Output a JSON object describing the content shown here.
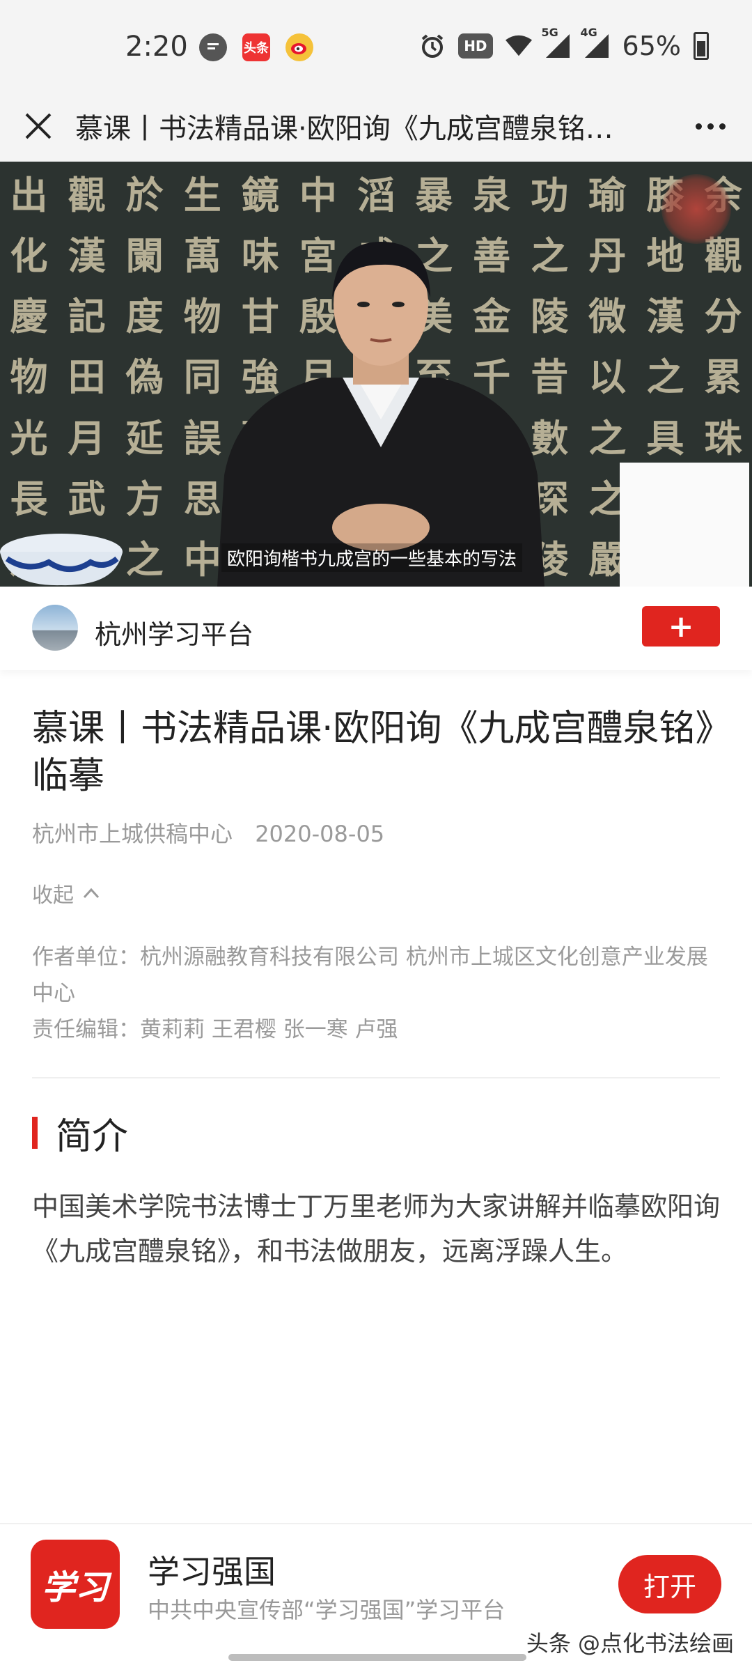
{
  "status_bar": {
    "time": "2:20",
    "network_5g": "5G",
    "network_4g": "4G",
    "hd_label": "HD",
    "battery": "65%",
    "app_icons": [
      "message-icon",
      "toutiao-icon",
      "weibo-icon"
    ],
    "toutiao_label": "头条"
  },
  "title_bar": {
    "title": "慕课丨书法精品课·欧阳询《九成宫醴泉铭…"
  },
  "video": {
    "subtitle": "欧阳询楷书九成宫的一些基本的写法"
  },
  "publisher": {
    "name": "杭州学习平台",
    "follow_label": "+"
  },
  "article": {
    "title": "慕课丨书法精品课·欧阳询《九成宫醴泉铭》临摹",
    "source": "杭州市上城供稿中心",
    "date": "2020-08-05",
    "collapse_label": "收起",
    "author_unit": "作者单位：杭州源融教育科技有限公司 杭州市上城区文化创意产业发展中心",
    "editors": "责任编辑：黄莉莉 王君樱 张一寒 卢强",
    "section_title": "简介",
    "intro": "中国美术学院书法博士丁万里老师为大家讲解并临摹欧阳询《九成宫醴泉铭》，和书法做朋友，远离浮躁人生。"
  },
  "app_banner": {
    "logo_text": "学习",
    "name": "学习强国",
    "description": "中共中央宣传部“学习强国”学习平台",
    "open_label": "打开"
  },
  "watermark": "头条 @点化书法绘画",
  "colors": {
    "accent": "#e0251f",
    "muted_text": "#9a9a9a",
    "bar_bg": "#f4f4f4"
  }
}
